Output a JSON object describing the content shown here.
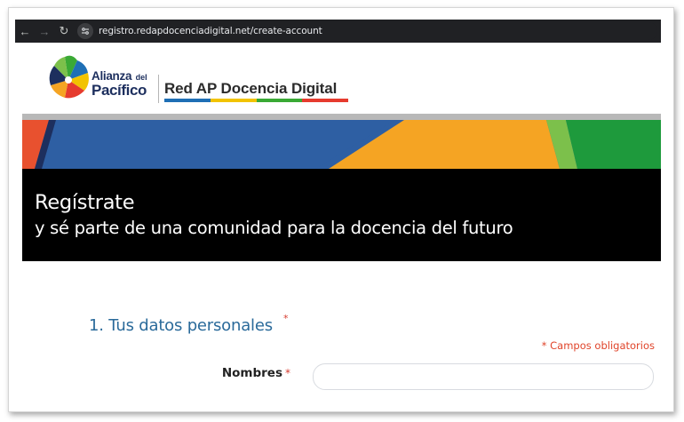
{
  "browser": {
    "back_icon": "←",
    "forward_icon": "→",
    "reload_icon": "↻",
    "url": "registro.redapdocenciadigital.net/create-account"
  },
  "header": {
    "alianza": "Alianza",
    "del": "del",
    "pacifico": "Pacífico",
    "network_name": "Red AP Docencia Digital",
    "bar_colors": [
      "#1f6fb5",
      "#f2c300",
      "#3aa935",
      "#e63b2e"
    ]
  },
  "banner": {
    "title": "Regístrate",
    "subtitle": "y sé parte de una comunidad para la docencia del futuro",
    "stripe_colors": [
      "#e8512f",
      "#2e5fa3",
      "#f5a423",
      "#3aa935",
      "#1e7a2f"
    ]
  },
  "form": {
    "section_title": "1. Tus datos personales",
    "section_required_mark": "*",
    "required_note": "* Campos obligatorios",
    "fields": {
      "nombres": {
        "label": "Nombres",
        "required_mark": "*",
        "value": "",
        "placeholder": ""
      }
    }
  },
  "colors": {
    "accent_blue": "#2a6a9a",
    "required_red": "#e0442a",
    "browser_dark": "#202124"
  }
}
